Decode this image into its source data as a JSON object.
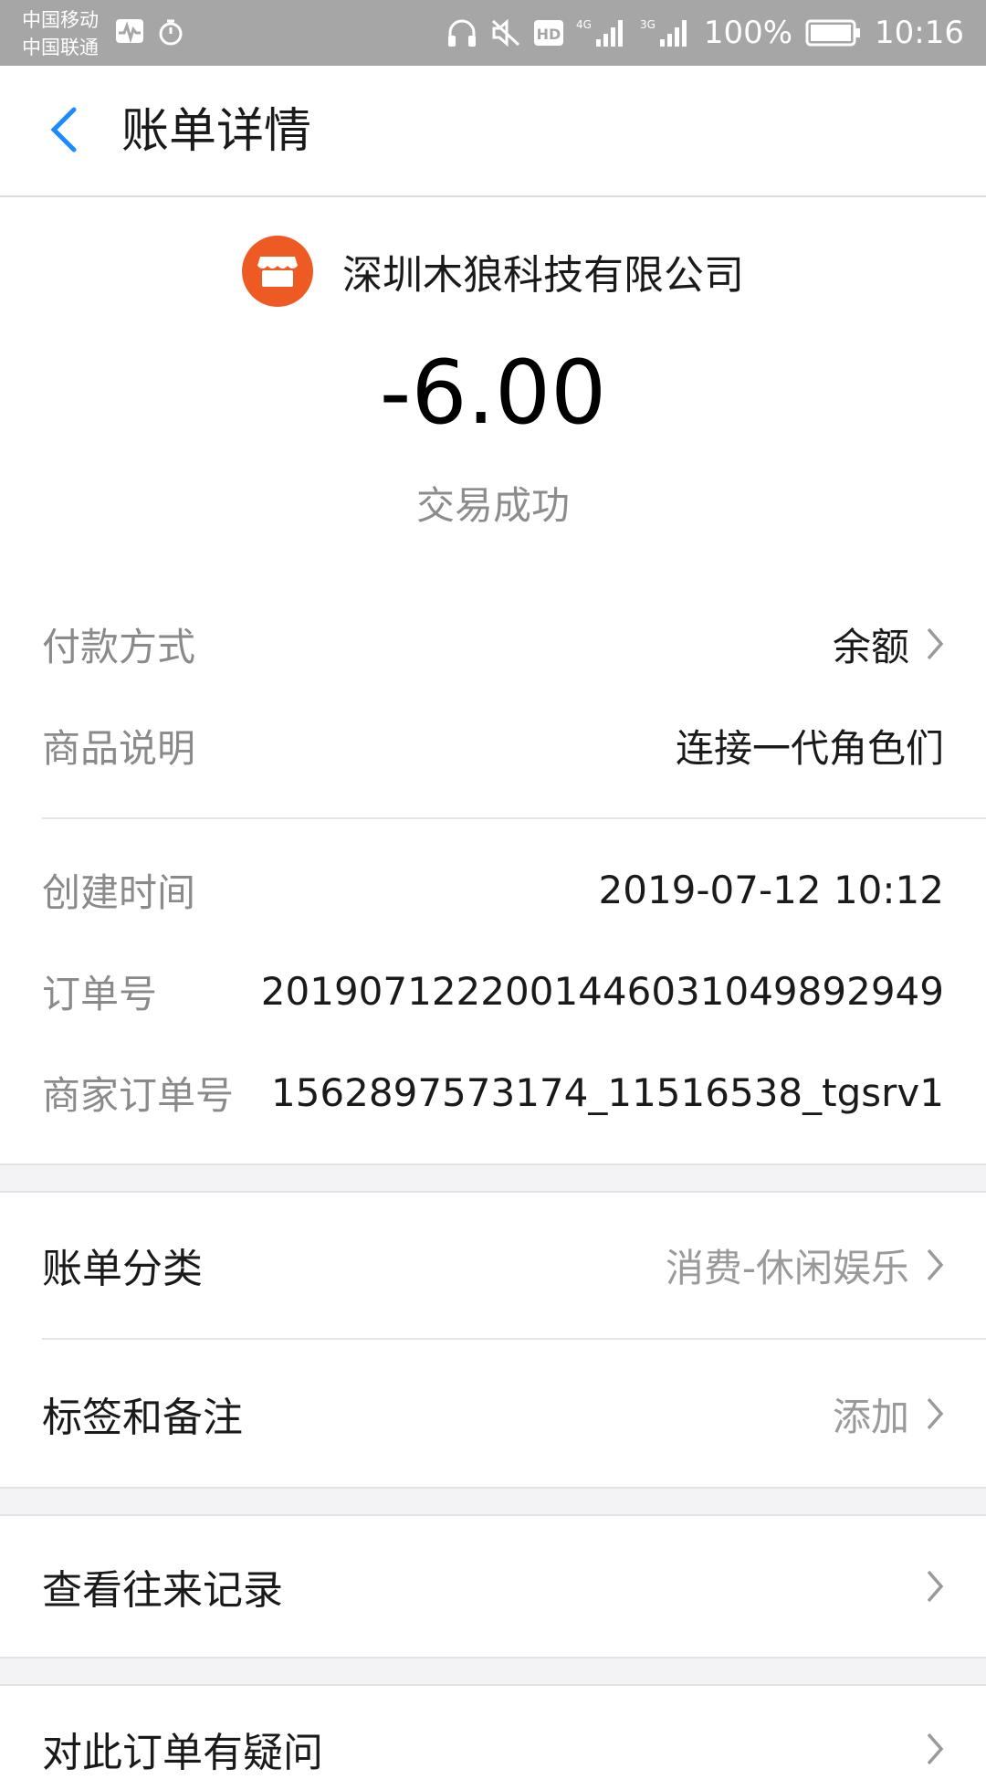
{
  "status_bar": {
    "carrier_1": "中国移动",
    "carrier_2": "中国联通",
    "network_4g": "4G",
    "network_3g": "3G",
    "battery": "100%",
    "time": "10:16"
  },
  "header": {
    "title": "账单详情"
  },
  "merchant": {
    "name": "深圳木狼科技有限公司",
    "logo_color": "#ee5a24"
  },
  "amount": "-6.00",
  "trade_status": "交易成功",
  "details": {
    "payment_method_label": "付款方式",
    "payment_method_value": "余额",
    "product_label": "商品说明",
    "product_value": "连接一代角色们",
    "created_label": "创建时间",
    "created_value": "2019-07-12 10:12",
    "order_no_label": "订单号",
    "order_no_value": "2019071222001446031049892949",
    "merchant_order_label": "商家订单号",
    "merchant_order_value": "1562897573174_11516538_tgsrv1"
  },
  "actions": {
    "category_label": "账单分类",
    "category_value": "消费-休闲娱乐",
    "tags_label": "标签和备注",
    "tags_value": "添加",
    "history_label": "查看往来记录",
    "question_label": "对此订单有疑问"
  },
  "colors": {
    "accent_blue": "#1a8cff",
    "muted": "#8a8a8a"
  }
}
